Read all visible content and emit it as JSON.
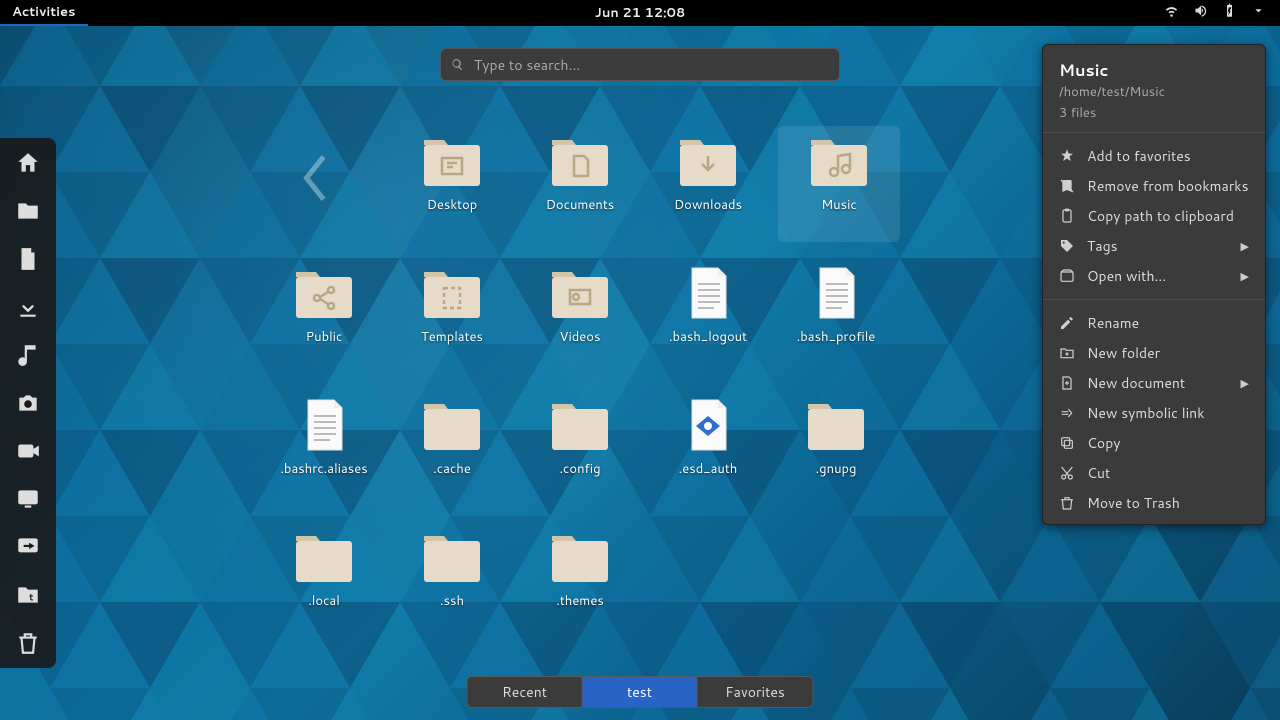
{
  "topbar": {
    "activities": "Activities",
    "clock": "Jun 21  12:08"
  },
  "search": {
    "placeholder": "Type to search..."
  },
  "sidebar": {
    "items": [
      {
        "name": "home-icon"
      },
      {
        "name": "folder-icon"
      },
      {
        "name": "document-icon"
      },
      {
        "name": "download-icon"
      },
      {
        "name": "music-icon"
      },
      {
        "name": "camera-icon"
      },
      {
        "name": "video-icon"
      },
      {
        "name": "screen-icon"
      },
      {
        "name": "share-icon"
      },
      {
        "name": "folder-t-icon"
      },
      {
        "name": "trash-icon"
      }
    ]
  },
  "grid": {
    "items": [
      {
        "label": "Desktop",
        "type": "folder",
        "glyph": "desktop"
      },
      {
        "label": "Documents",
        "type": "folder",
        "glyph": "document"
      },
      {
        "label": "Downloads",
        "type": "folder",
        "glyph": "download"
      },
      {
        "label": "Music",
        "type": "folder",
        "glyph": "music",
        "selected": true
      },
      {
        "label": "Public",
        "type": "folder",
        "glyph": "share"
      },
      {
        "label": "Templates",
        "type": "folder",
        "glyph": "template"
      },
      {
        "label": "Videos",
        "type": "folder",
        "glyph": "video"
      },
      {
        "label": ".bash_logout",
        "type": "file",
        "glyph": "text"
      },
      {
        "label": ".bash_profile",
        "type": "file",
        "glyph": "text"
      },
      {
        "label": ".bashrc.aliases",
        "type": "file",
        "glyph": "text"
      },
      {
        "label": ".cache",
        "type": "folder",
        "glyph": "none"
      },
      {
        "label": ".config",
        "type": "folder",
        "glyph": "none"
      },
      {
        "label": ".esd_auth",
        "type": "file",
        "glyph": "auth"
      },
      {
        "label": ".gnupg",
        "type": "folder",
        "glyph": "none"
      },
      {
        "label": ".local",
        "type": "folder",
        "glyph": "none"
      },
      {
        "label": ".ssh",
        "type": "folder",
        "glyph": "none"
      },
      {
        "label": ".themes",
        "type": "folder",
        "glyph": "none"
      }
    ]
  },
  "panel": {
    "title": "Music",
    "path": "/home/test/Music",
    "count": "3 files",
    "group1": [
      {
        "icon": "star",
        "label": "Add to favorites"
      },
      {
        "icon": "bookmark-remove",
        "label": "Remove from bookmarks"
      },
      {
        "icon": "clipboard",
        "label": "Copy path to clipboard"
      },
      {
        "icon": "tag",
        "label": "Tags",
        "sub": true
      },
      {
        "icon": "open",
        "label": "Open with...",
        "sub": true
      }
    ],
    "group2": [
      {
        "icon": "pencil",
        "label": "Rename"
      },
      {
        "icon": "newfolder",
        "label": "New folder"
      },
      {
        "icon": "newdoc",
        "label": "New document",
        "sub": true
      },
      {
        "icon": "symlink",
        "label": "New symbolic link"
      },
      {
        "icon": "copy",
        "label": "Copy"
      },
      {
        "icon": "cut",
        "label": "Cut"
      },
      {
        "icon": "trash",
        "label": "Move to Trash"
      }
    ]
  },
  "bottom": {
    "tabs": [
      {
        "label": "Recent",
        "active": false
      },
      {
        "label": "test",
        "active": true
      },
      {
        "label": "Favorites",
        "active": false
      }
    ]
  }
}
